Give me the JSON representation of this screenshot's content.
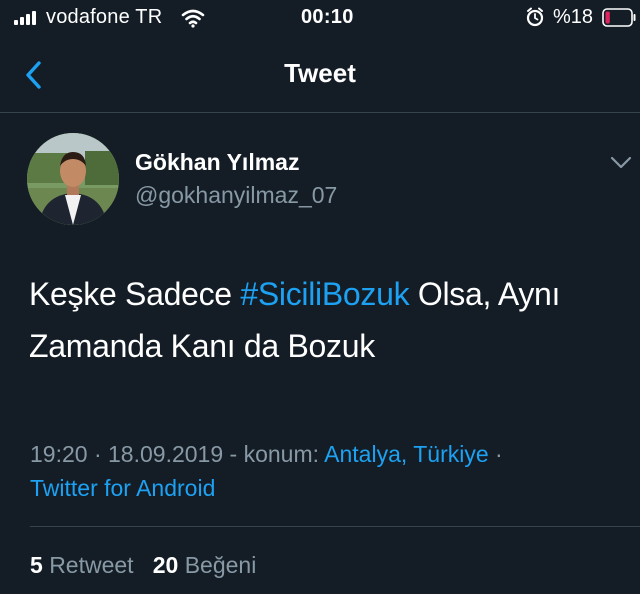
{
  "status_bar": {
    "carrier": "vodafone TR",
    "time": "00:10",
    "battery_percent": "%18",
    "battery_level": 0.18,
    "icons": [
      "signal-icon",
      "wifi-icon",
      "alarm-icon",
      "battery-icon"
    ]
  },
  "nav": {
    "title": "Tweet",
    "back_icon": "chevron-left-icon"
  },
  "tweet": {
    "author_name": "Gökhan Yılmaz",
    "author_handle": "@gokhanyilmaz_07",
    "text_before": "Keşke Sadece ",
    "hashtag": "#SiciliBozuk",
    "text_after": " Olsa, Aynı Zamanda Kanı da Bozuk",
    "time": "19:20",
    "date": "18.09.2019",
    "location_label": "konum:",
    "location": "Antalya, Türkiye",
    "source": "Twitter for Android",
    "retweet_count": "5",
    "retweet_label": "Retweet",
    "like_count": "20",
    "like_label": "Beğeni"
  },
  "colors": {
    "background": "#141d26",
    "accent": "#1da1f2",
    "secondary_text": "#8899a6",
    "divider": "#38444d",
    "battery_low": "#e0245e"
  }
}
